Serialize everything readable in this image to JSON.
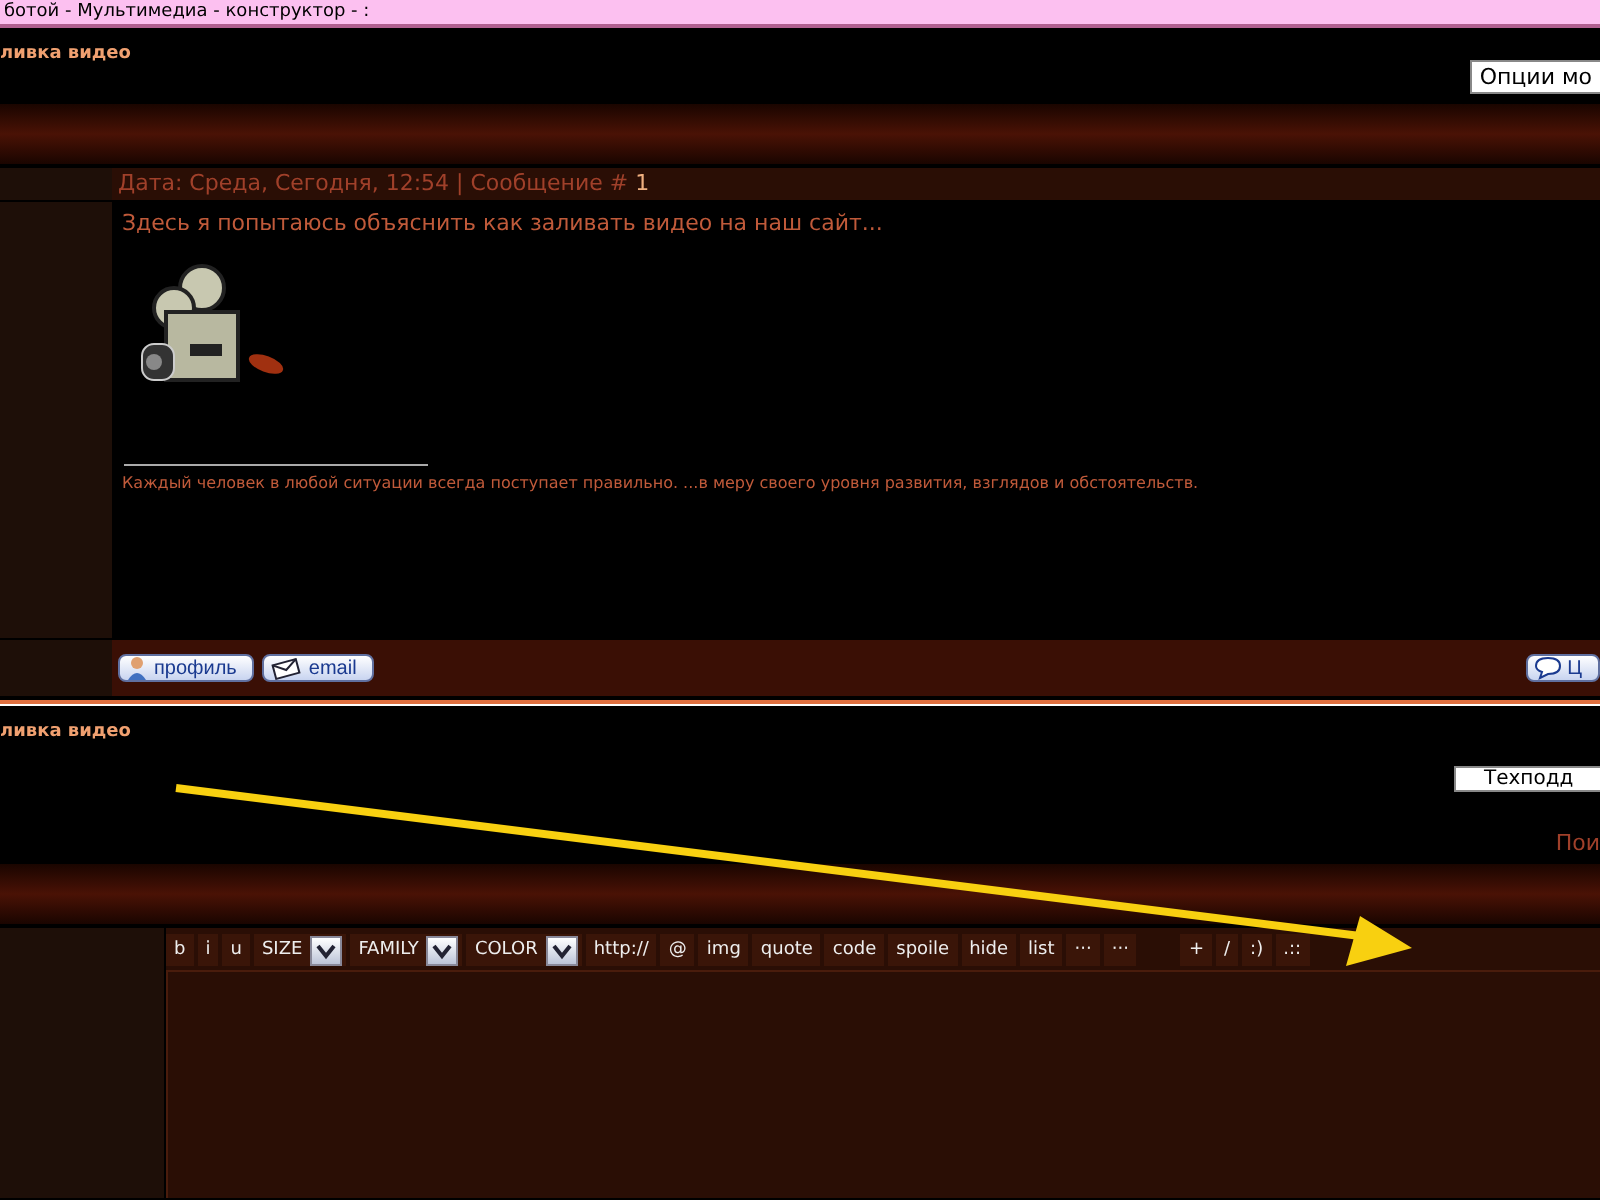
{
  "breadcrumb": "ботой - Мультимедиа - конструктор - :",
  "header": {
    "title": "ливка видео",
    "options_button": "Опции мо"
  },
  "post": {
    "date_line": "Дата: Среда, Сегодня, 12:54 | Сообщение # ",
    "post_number": "1",
    "text": "Здесь я попытаюсь объяснить как заливать видео на наш сайт...",
    "signature": "Каждый человек в любой ситуации всегда поступает правильно. ...в меру своего уровня развития, взглядов и обстоятельств.",
    "buttons": [
      {
        "kind": "profile",
        "label": "профиль"
      },
      {
        "kind": "email",
        "label": "email"
      },
      {
        "kind": "quote",
        "label": "Ц"
      }
    ]
  },
  "footer": {
    "title": "ливка видео",
    "support_button": "Техподд",
    "search_link": "Пои"
  },
  "toolbar": [
    {
      "kind": "button",
      "label": "b"
    },
    {
      "kind": "button",
      "label": "i"
    },
    {
      "kind": "button",
      "label": "u"
    },
    {
      "kind": "select",
      "label": "SIZE"
    },
    {
      "kind": "select",
      "label": "FAMILY"
    },
    {
      "kind": "select",
      "label": "COLOR"
    },
    {
      "kind": "button",
      "label": "http://"
    },
    {
      "kind": "button",
      "label": "@"
    },
    {
      "kind": "button",
      "label": "img"
    },
    {
      "kind": "button",
      "label": "quote"
    },
    {
      "kind": "button",
      "label": "code"
    },
    {
      "kind": "button",
      "label": "spoile"
    },
    {
      "kind": "button",
      "label": "hide"
    },
    {
      "kind": "button",
      "label": "list"
    },
    {
      "kind": "button",
      "label": "···"
    },
    {
      "kind": "button",
      "label": "···"
    },
    {
      "kind": "spacer"
    },
    {
      "kind": "button",
      "label": "+"
    },
    {
      "kind": "button",
      "label": "/"
    },
    {
      "kind": "button",
      "label": ":)"
    },
    {
      "kind": "button",
      "label": ".::"
    }
  ]
}
